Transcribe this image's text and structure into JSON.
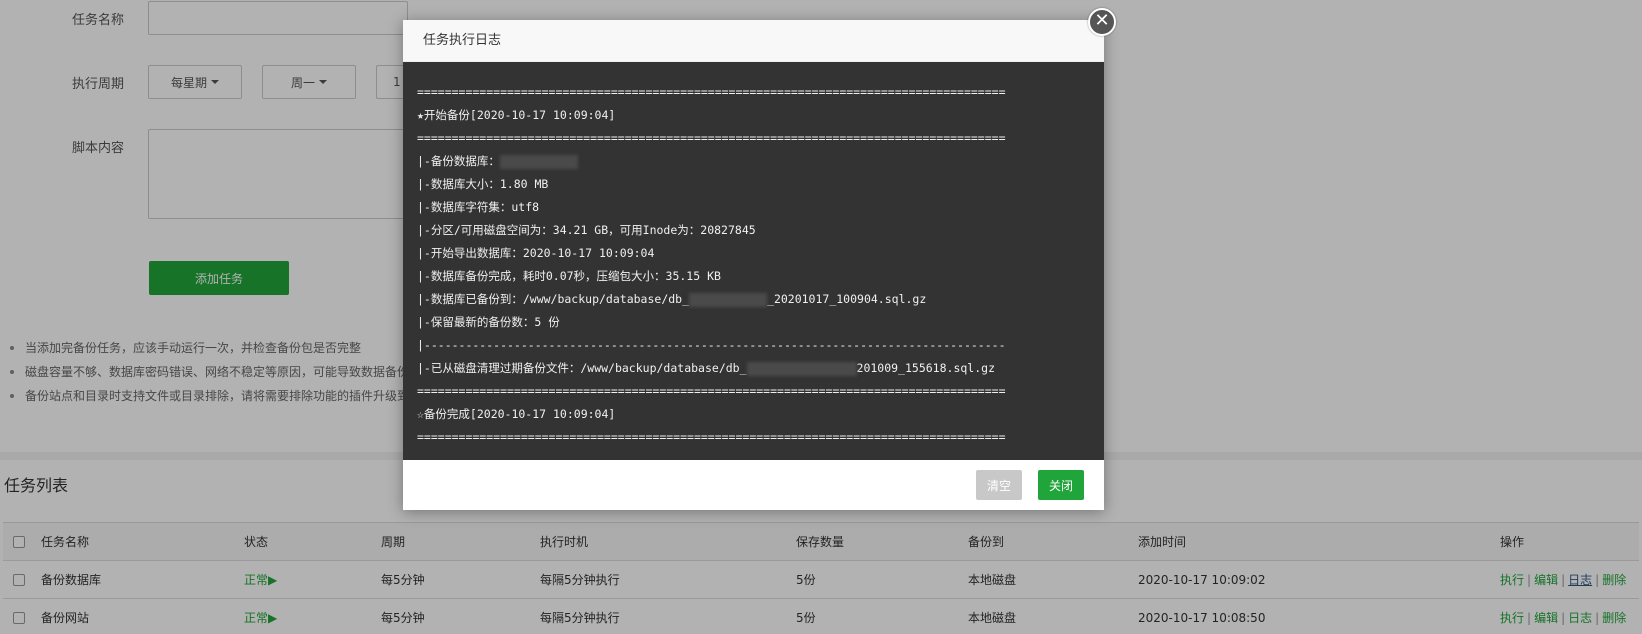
{
  "form": {
    "task_name_label": "任务名称",
    "task_name_value": "",
    "cycle_label": "执行周期",
    "cycle_type": "每星期",
    "cycle_day": "周一",
    "cycle_extra": "1",
    "script_label": "脚本内容",
    "script_value": "",
    "add_button": "添加任务"
  },
  "tips": [
    "当添加完备份任务，应该手动运行一次，并检查备份包是否完整",
    "磁盘容量不够、数据库密码错误、网络不稳定等原因，可能导致数据备份",
    "备份站点和目录时支持文件或目录排除，请将需要排除功能的插件升级到"
  ],
  "task_list": {
    "title": "任务列表",
    "columns": [
      "任务名称",
      "状态",
      "周期",
      "执行时机",
      "保存数量",
      "备份到",
      "添加时间",
      "操作"
    ],
    "rows": [
      {
        "name": "备份数据库",
        "status": "正常▶",
        "cycle": "每5分钟",
        "timing": "每隔5分钟执行",
        "keep": "5份",
        "target": "本地磁盘",
        "added": "2020-10-17 10:09:02",
        "ops": [
          "执行",
          "编辑",
          "日志",
          "删除"
        ]
      },
      {
        "name": "备份网站",
        "status": "正常▶",
        "cycle": "每5分钟",
        "timing": "每隔5分钟执行",
        "keep": "5份",
        "target": "本地磁盘",
        "added": "2020-10-17 10:08:50",
        "ops": [
          "执行",
          "编辑",
          "日志",
          "删除"
        ]
      }
    ],
    "op_separator": "|"
  },
  "modal": {
    "title": "任务执行日志",
    "close_icon": "✕",
    "log": {
      "sep_eq": "=====================================================================================",
      "sep_dash": "|------------------------------------------------------------------------------------",
      "start": "★开始备份[2020-10-17 10:09:04]",
      "db_prefix": "|-备份数据库：",
      "size": "|-数据库大小：1.80 MB",
      "charset": "|-数据库字符集：utf8",
      "disk": "|-分区/可用磁盘空间为：34.21 GB，可用Inode为：20827845",
      "export_start": "|-开始导出数据库：2020-10-17 10:09:04",
      "done_time": "|-数据库备份完成，耗时0.07秒，压缩包大小：35.15 KB",
      "saved_prefix": "|-数据库已备份到：/www/backup/database/db_",
      "saved_suffix": "_20201017_100904.sql.gz",
      "keep": "|-保留最新的备份数：5 份",
      "cleanup_prefix": "|-已从磁盘清理过期备份文件：/www/backup/database/db_",
      "cleanup_suffix": "201009_155618.sql.gz",
      "finish": "☆备份完成[2020-10-17 10:09:04]"
    },
    "clear_button": "清空",
    "close_button": "关闭"
  },
  "colors": {
    "accent_green": "#20a53a",
    "log_background": "#333333",
    "link_blue": "#2b5a87"
  }
}
